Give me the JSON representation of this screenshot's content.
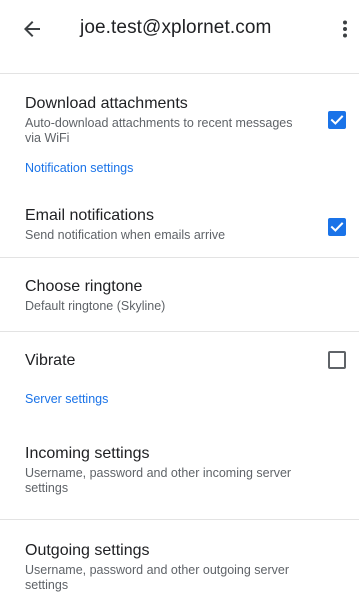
{
  "header": {
    "title": "joe.test@xplornet.com"
  },
  "settings": {
    "download_attachments": {
      "label": "Download attachments",
      "summary": "Auto-download attachments to recent messages via WiFi",
      "checked": true
    },
    "notification_section": "Notification settings",
    "email_notifications": {
      "label": "Email notifications",
      "summary": "Send notification when emails arrive",
      "checked": true
    },
    "choose_ringtone": {
      "label": "Choose ringtone",
      "summary": "Default ringtone (Skyline)"
    },
    "vibrate": {
      "label": "Vibrate",
      "checked": false
    },
    "server_section": "Server settings",
    "incoming_settings": {
      "label": "Incoming settings",
      "summary": "Username, password and other incoming server settings"
    },
    "outgoing_settings": {
      "label": "Outgoing settings",
      "summary": "Username, password and other outgoing server settings"
    }
  },
  "colors": {
    "accent": "#1a73e8",
    "text_primary": "#202124",
    "text_secondary": "#5f6368",
    "divider": "#e3e3e3"
  },
  "icons": {
    "back": "arrow-back-icon",
    "more": "more-vert-icon",
    "check": "check-icon"
  }
}
